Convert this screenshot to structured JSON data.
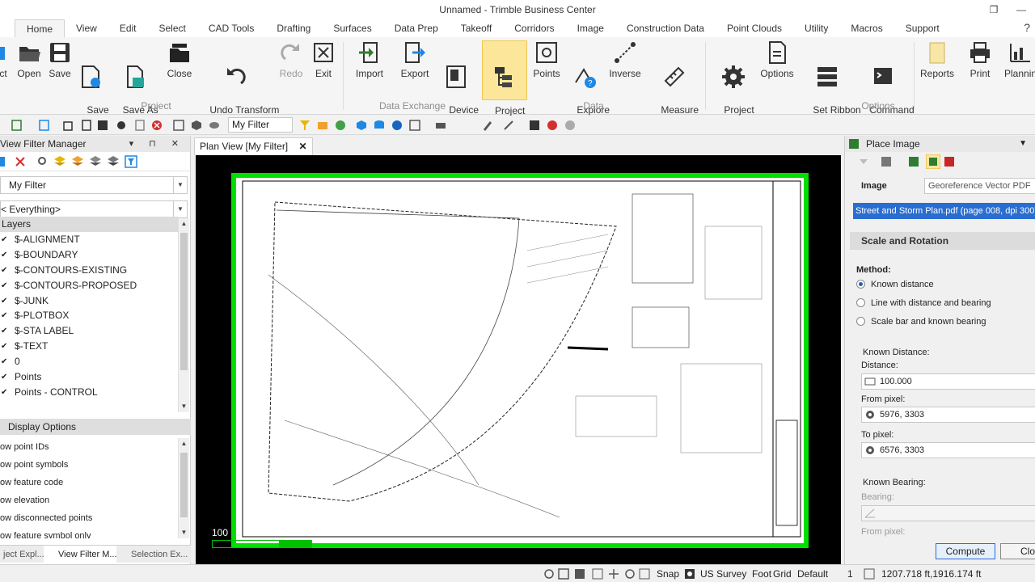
{
  "window": {
    "title": "Unnamed - Trimble Business Center"
  },
  "tabs": [
    "Home",
    "View",
    "Edit",
    "Select",
    "CAD Tools",
    "Drafting",
    "Surfaces",
    "Data Prep",
    "Takeoff",
    "Corridors",
    "Image",
    "Construction Data",
    "Point Clouds",
    "Utility",
    "Macros",
    "Support"
  ],
  "ribbon": {
    "buttons": {
      "project": "ct",
      "open": "Open",
      "save": "Save",
      "save_as": "Save\nAs",
      "save_as_template": "Save As\nTemplate...",
      "close": "Close",
      "undo": "Undo Transform\nimage",
      "redo": "Redo",
      "exit": "Exit",
      "import": "Import",
      "export": "Export",
      "device_pane": "Device\nPane",
      "project_explorer": "Project\nExplorer",
      "points": "Points",
      "explore_object": "Explore\nObject",
      "inverse": "Inverse",
      "measure_distance": "Measure\nDistance",
      "project_settings": "Project\nSettings",
      "options": "Options",
      "set_ribbon_tabs": "Set Ribbon\nTabs",
      "command_pane": "Command\nPane",
      "reports": "Reports",
      "print": "Print",
      "planning": "Plannin"
    },
    "groups": {
      "project": "Project",
      "data_exchange": "Data Exchange",
      "data": "Data",
      "options": "Options"
    }
  },
  "toolbar": {
    "filter_value": "My Filter"
  },
  "left_panel": {
    "title": "View Filter Manager",
    "filter_dropdown": "My Filter",
    "scope_dropdown": "< Everything>",
    "layers_header": "Layers",
    "layers": [
      "$-ALIGNMENT",
      "$-BOUNDARY",
      "$-CONTOURS-EXISTING",
      "$-CONTOURS-PROPOSED",
      "$-JUNK",
      "$-PLOTBOX",
      "$-STA LABEL",
      "$-TEXT",
      "0",
      "Points",
      "Points - CONTROL"
    ],
    "display_options_header": "Display Options",
    "display_options": [
      "ow point IDs",
      "ow point symbols",
      "ow feature code",
      "ow elevation",
      "ow disconnected points",
      "ow feature symbol only"
    ],
    "bottom_tabs": [
      "ject Expl...",
      "View Filter M...",
      "Selection Ex..."
    ]
  },
  "plan_view": {
    "tab_label": "Plan View [My Filter]",
    "scale_label": "100"
  },
  "right_panel": {
    "title": "Place Image",
    "image_label": "Image",
    "image_type": "Georeference Vector PDF",
    "image_file": "Street and Storm Plan.pdf  (page 008, dpi 300)",
    "scale_rotation_header": "Scale and Rotation",
    "method_label": "Method:",
    "methods": [
      "Known distance",
      "Line with distance and bearing",
      "Scale bar and known bearing"
    ],
    "selected_method": 0,
    "known_distance_label": "Known Distance:",
    "distance_label": "Distance:",
    "distance_value": "100.000",
    "from_pixel_label": "From pixel:",
    "from_pixel_value": "5976, 3303",
    "to_pixel_label": "To pixel:",
    "to_pixel_value": "6576, 3303",
    "known_bearing_label": "Known Bearing:",
    "bearing_label": "Bearing:",
    "from_pixel2_label": "From pixel:",
    "compute_button": "Compute",
    "close_button": "Clos"
  },
  "status_bar": {
    "snap": "Snap",
    "units": "US Survey  Foot",
    "grid": "Grid",
    "default": "Default",
    "count": "1",
    "coords": "1207.718 ft,1916.174 ft"
  },
  "colors": {
    "accent_green": "#00e000",
    "active_button": "#fbe69a",
    "selection_blue": "#2a6dd0"
  }
}
